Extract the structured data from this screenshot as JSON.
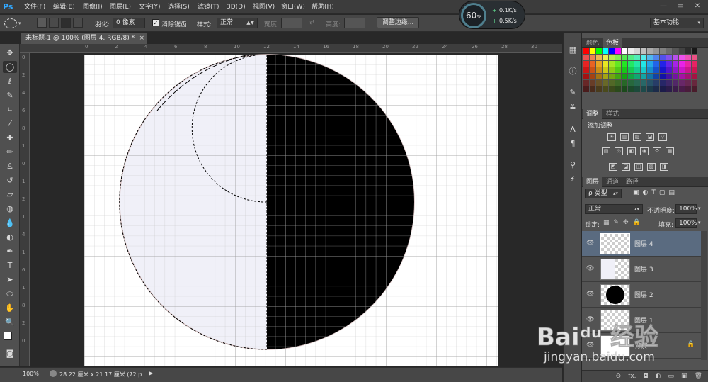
{
  "menubar": {
    "logo": "Ps",
    "items": [
      "文件(F)",
      "编辑(E)",
      "图像(I)",
      "图层(L)",
      "文字(Y)",
      "选择(S)",
      "滤镜(T)",
      "3D(D)",
      "视图(V)",
      "窗口(W)",
      "帮助(H)"
    ],
    "window_buttons": [
      "—",
      "▭",
      "✕"
    ]
  },
  "options": {
    "feather_label": "羽化:",
    "feather_value": "0 像素",
    "antialias_label": "消除锯齿",
    "style_label": "样式:",
    "style_value": "正常",
    "width_label": "宽度:",
    "height_label": "高度:",
    "refine_edge_button": "调整边缘...",
    "workspace_value": "基本功能"
  },
  "meter": {
    "percent": "60",
    "percent_unit": "%",
    "up_rate": "0.1K/s",
    "down_rate": "0.5K/s",
    "up_symbol": "+",
    "down_symbol": "+"
  },
  "document": {
    "tab_title": "未标题-1 @ 100% (图层 4, RGB/8) *",
    "tab_close": "×"
  },
  "ruler": {
    "h_labels": [
      "0",
      "2",
      "4",
      "6",
      "8",
      "10",
      "12",
      "14",
      "16",
      "18",
      "20",
      "22",
      "24",
      "26",
      "28",
      "30"
    ],
    "v_labels": [
      "0",
      "2",
      "4",
      "6",
      "8",
      "1",
      "0",
      "1",
      "2",
      "1",
      "4",
      "1",
      "6",
      "1",
      "8",
      "2",
      "0"
    ]
  },
  "status": {
    "zoom": "100%",
    "doc_info": "28.22 厘米 x 21.17 厘米 (72 p...",
    "arrow": "▶"
  },
  "panels": {
    "color_tabs": [
      "颜色",
      "色板"
    ],
    "adjust_tabs": [
      "调整",
      "样式"
    ],
    "adjust_title": "添加调整",
    "adjust_icons_row1": [
      "☀",
      "▥",
      "▨",
      "◪",
      "▽"
    ],
    "adjust_icons_row2": [
      "▤",
      "⚖",
      "◧",
      "◉",
      "✿",
      "▦"
    ],
    "adjust_icons_row3": [
      "◩",
      "◪",
      "◫",
      "▧",
      "◨"
    ],
    "layers_tabs": [
      "图层",
      "通道",
      "路径"
    ],
    "filter_label": "ρ 类型",
    "blend_mode": "正常",
    "opacity_label": "不透明度:",
    "opacity_value": "100%",
    "lock_label": "锁定:",
    "fill_label": "填充:",
    "fill_value": "100%",
    "layers": [
      {
        "name": "图层 4",
        "selected": true
      },
      {
        "name": "图层 3",
        "selected": false
      },
      {
        "name": "图层 2",
        "selected": false
      },
      {
        "name": "图层 1",
        "selected": false
      },
      {
        "name": "背景",
        "selected": false
      }
    ],
    "layers_footer": [
      "⊝",
      "fx.",
      "◘",
      "◐",
      "▭",
      "▣",
      "🗑"
    ]
  },
  "watermark": {
    "logo_text": "Baiᵈᵘ 经验",
    "url": "jingyan.baidu.com"
  },
  "colors": {
    "accent": "#31a8ff",
    "canvas_left": "#f0f0f8",
    "canvas_right": "#000000",
    "layer_selected": "#5a6b80"
  }
}
